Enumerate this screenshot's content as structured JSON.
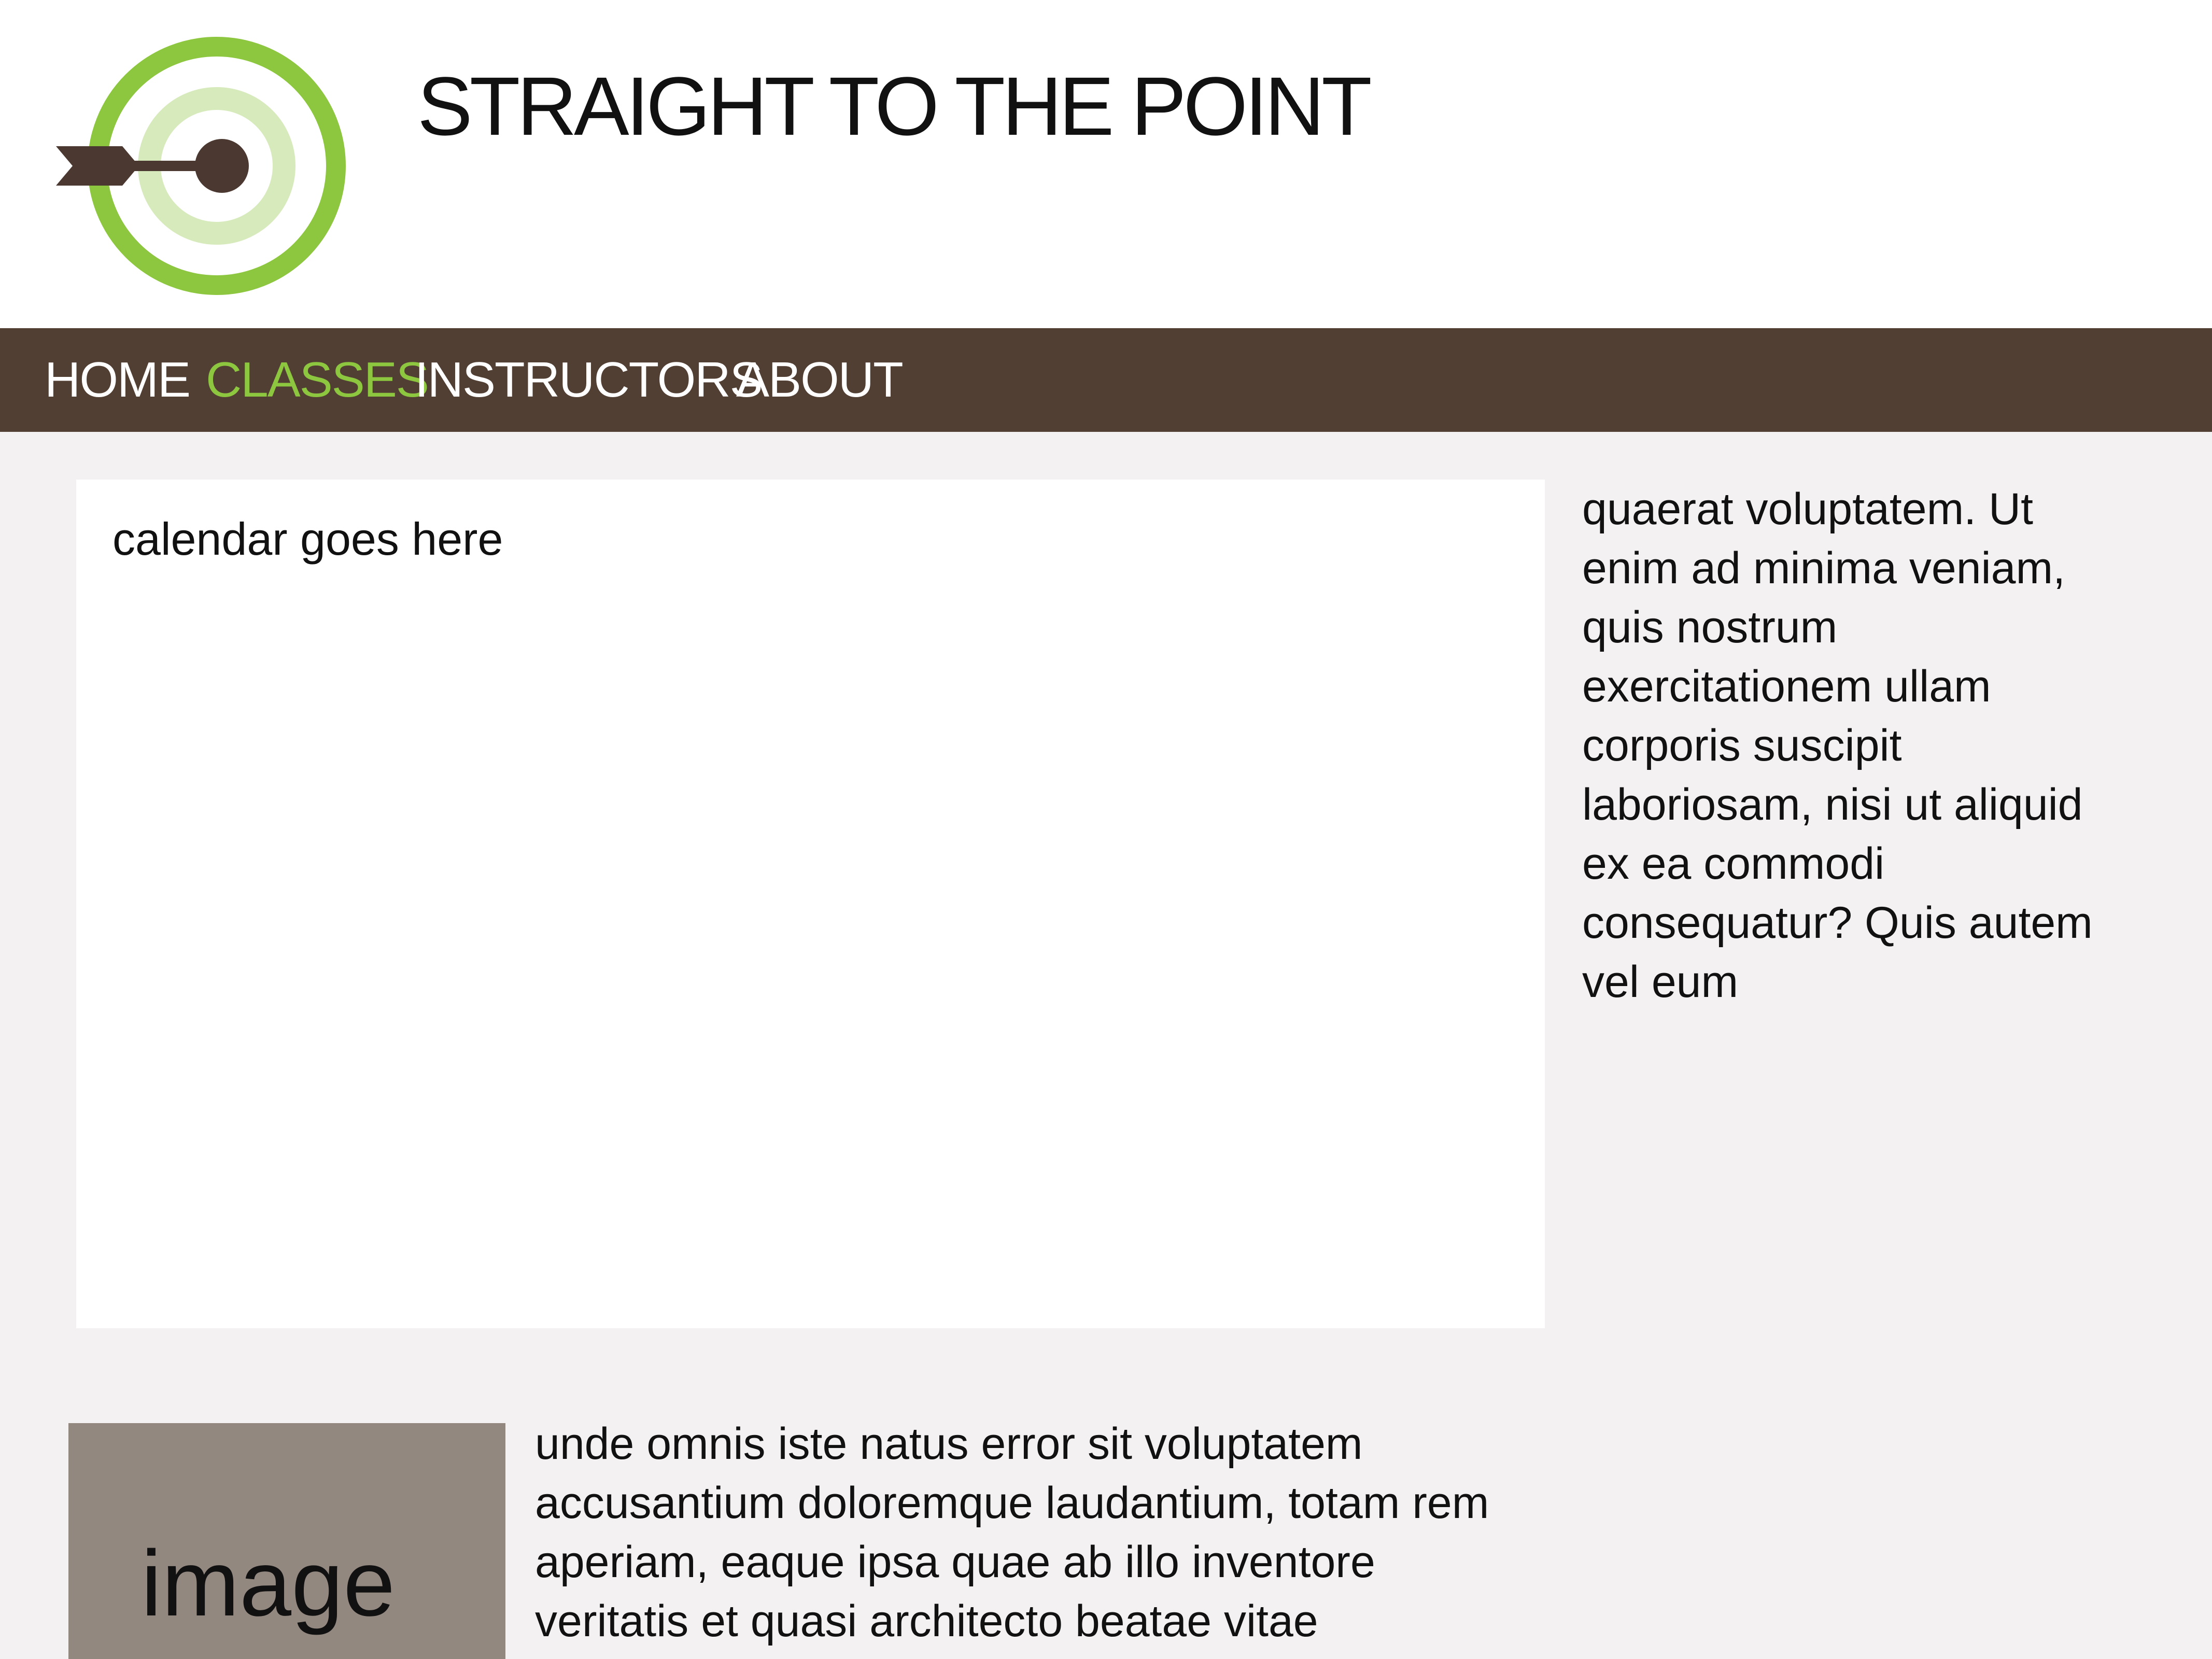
{
  "header": {
    "title": "STRAIGHT TO THE POINT"
  },
  "nav": {
    "items": [
      {
        "label": "HOME"
      },
      {
        "label": "CLASSES"
      },
      {
        "label": "INSTRUCTORS"
      },
      {
        "label": "ABOUT"
      }
    ],
    "active": "CLASSES"
  },
  "main": {
    "calendar_placeholder": "calendar goes here",
    "sidebar_text": "quaerat voluptatem. Ut enim ad minima veniam, quis nostrum exercitationem ullam corporis suscipit laboriosam, nisi ut aliquid ex ea commodi consequatur? Quis autem vel eum",
    "image_placeholder": "image",
    "body_text": "unde omnis iste natus error sit voluptatem accusantium doloremque laudantium, totam rem aperiam, eaque ipsa quae ab illo inventore veritatis et quasi architecto beatae vitae"
  },
  "colors": {
    "nav_background": "#523f34",
    "accent": "#8dc63f",
    "page_background": "#f3f1f1",
    "image_placeholder": "#938880"
  },
  "icons": {
    "logo": "target-dart-icon"
  }
}
